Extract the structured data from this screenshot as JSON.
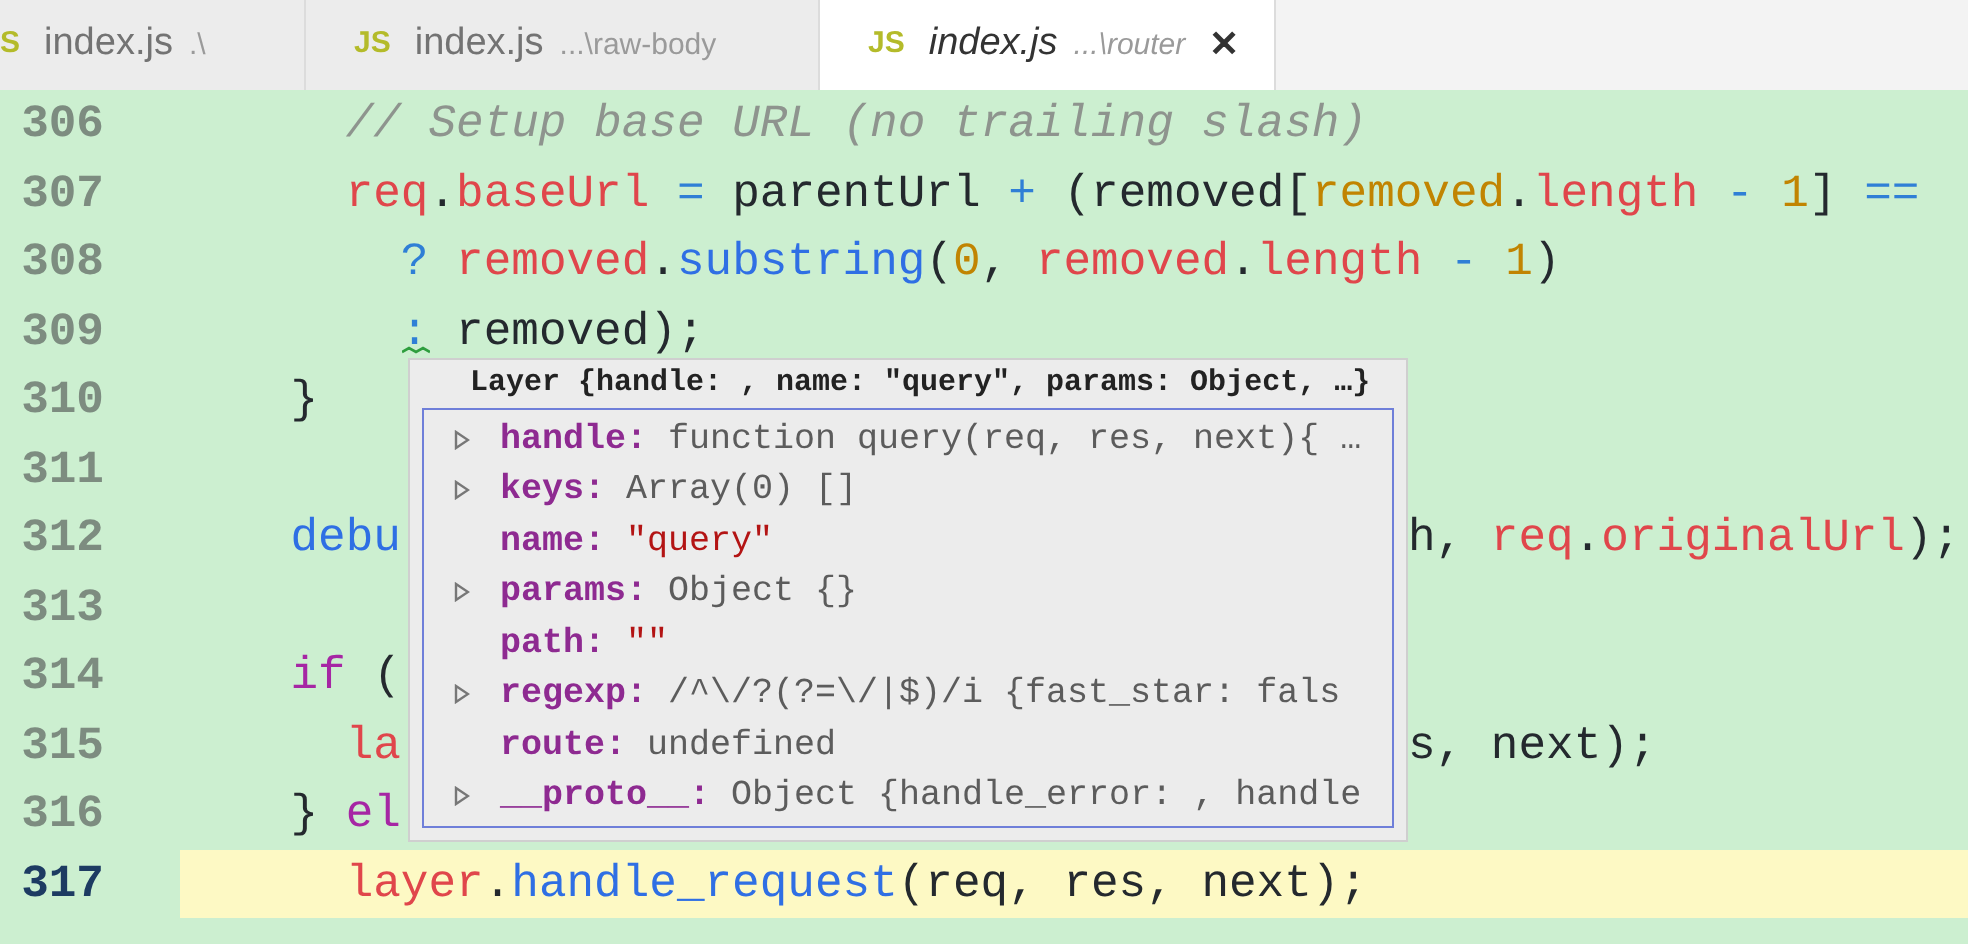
{
  "tabs": [
    {
      "icon": "S",
      "label": "index.js",
      "path": ".\\",
      "selected": false
    },
    {
      "icon": "JS",
      "label": "index.js",
      "path": "...\\raw-body",
      "selected": false
    },
    {
      "icon": "JS",
      "label": "index.js",
      "path": "...\\router",
      "selected": true,
      "close": "✕"
    }
  ],
  "editor": {
    "lines": [
      {
        "number": "306",
        "current": false,
        "tokens": [
          {
            "text": "      // Setup base URL (no trailing slash)",
            "kind": "comment"
          }
        ]
      },
      {
        "number": "307",
        "current": false,
        "tokens": [
          {
            "text": "      req",
            "kind": "variable"
          },
          {
            "text": ".",
            "kind": "plain"
          },
          {
            "text": "baseUrl",
            "kind": "variable"
          },
          {
            "text": " = ",
            "kind": "operator"
          },
          {
            "text": "parentUrl ",
            "kind": "plain"
          },
          {
            "text": "+",
            "kind": "operator"
          },
          {
            "text": " (removed[",
            "kind": "plain"
          },
          {
            "text": "removed",
            "kind": "number"
          },
          {
            "text": ".",
            "kind": "plain"
          },
          {
            "text": "length",
            "kind": "variable"
          },
          {
            "text": " - ",
            "kind": "operator"
          },
          {
            "text": "1",
            "kind": "number"
          },
          {
            "text": "] ",
            "kind": "plain"
          },
          {
            "text": "==",
            "kind": "operator"
          }
        ]
      },
      {
        "number": "308",
        "current": false,
        "tokens": [
          {
            "text": "        ?",
            "kind": "operator"
          },
          {
            "text": " removed",
            "kind": "variable"
          },
          {
            "text": ".",
            "kind": "plain"
          },
          {
            "text": "substring",
            "kind": "function"
          },
          {
            "text": "(",
            "kind": "plain"
          },
          {
            "text": "0",
            "kind": "number"
          },
          {
            "text": ", ",
            "kind": "plain"
          },
          {
            "text": "removed",
            "kind": "variable"
          },
          {
            "text": ".",
            "kind": "plain"
          },
          {
            "text": "length",
            "kind": "variable"
          },
          {
            "text": " - ",
            "kind": "operator"
          },
          {
            "text": "1",
            "kind": "number"
          },
          {
            "text": ")",
            "kind": "plain"
          }
        ]
      },
      {
        "number": "309",
        "current": false,
        "squiggle": true,
        "tokens": [
          {
            "text": "        :",
            "kind": "operator"
          },
          {
            "text": " removed);",
            "kind": "plain"
          }
        ]
      },
      {
        "number": "310",
        "current": false,
        "tokens": [
          {
            "text": "    }",
            "kind": "plain"
          }
        ]
      },
      {
        "number": "311",
        "current": false
      },
      {
        "number": "312",
        "current": false,
        "tokens": [
          {
            "text": "    debu",
            "kind": "function"
          }
        ],
        "tail": [
          {
            "text": "h, ",
            "kind": "plain"
          },
          {
            "text": "req",
            "kind": "variable"
          },
          {
            "text": ".",
            "kind": "plain"
          },
          {
            "text": "originalUrl",
            "kind": "variable"
          },
          {
            "text": ");",
            "kind": "plain"
          }
        ]
      },
      {
        "number": "313",
        "current": false
      },
      {
        "number": "314",
        "current": false,
        "tokens": [
          {
            "text": "    if",
            "kind": "keyword"
          },
          {
            "text": " (",
            "kind": "plain"
          }
        ]
      },
      {
        "number": "315",
        "current": false,
        "tokens": [
          {
            "text": "      la",
            "kind": "variable"
          }
        ],
        "tail": [
          {
            "text": "s, next);",
            "kind": "plain"
          }
        ]
      },
      {
        "number": "316",
        "current": false,
        "tokens": [
          {
            "text": "    } ",
            "kind": "plain"
          },
          {
            "text": "el",
            "kind": "keyword"
          }
        ]
      },
      {
        "number": "317",
        "current": true,
        "tokens": [
          {
            "text": "      layer",
            "kind": "variable"
          },
          {
            "text": ".",
            "kind": "plain"
          },
          {
            "text": "handle_request",
            "kind": "function"
          },
          {
            "text": "(req, res, next);",
            "kind": "plain"
          }
        ]
      }
    ]
  },
  "popup": {
    "title": "Layer {handle: , name: \"query\", params: Object, …}",
    "rows": [
      {
        "key": "handle:",
        "expandable": true,
        "value": "function query(req, res, next){ …",
        "kind": "object"
      },
      {
        "key": "keys:",
        "expandable": true,
        "value": "Array(0) []",
        "kind": "object"
      },
      {
        "key": "name:",
        "expandable": false,
        "value": "\"query\"",
        "kind": "string"
      },
      {
        "key": "params:",
        "expandable": true,
        "value": "Object {}",
        "kind": "object"
      },
      {
        "key": "path:",
        "expandable": false,
        "value": "\"\"",
        "kind": "string"
      },
      {
        "key": "regexp:",
        "expandable": true,
        "value": "/^\\/?(?=\\/|$)/i {fast_star: fals",
        "kind": "object"
      },
      {
        "key": "route:",
        "expandable": false,
        "value": "undefined",
        "kind": "object"
      },
      {
        "key": "__proto__:",
        "expandable": true,
        "value": "Object {handle_error: , handle",
        "kind": "object"
      }
    ]
  }
}
